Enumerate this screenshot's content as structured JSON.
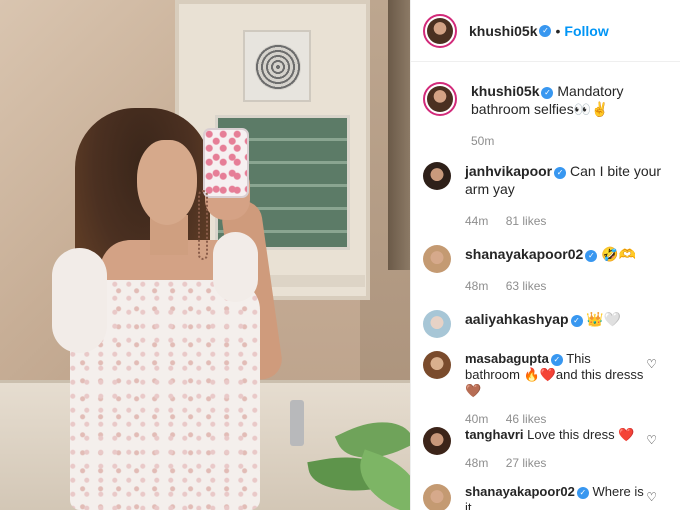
{
  "post": {
    "author": "khushi05k",
    "follow_label": "Follow",
    "separator": "•"
  },
  "caption": {
    "username": "khushi05k",
    "text": "Mandatory bathroom selfies👀✌",
    "time": "50m"
  },
  "comments": [
    {
      "username": "janhvikapoor",
      "text": "Can I bite your arm yay",
      "time": "44m",
      "likes": "81 likes"
    },
    {
      "username": "shanayakapoor02",
      "text": "🤣🫶",
      "time": "48m",
      "likes": "63 likes"
    },
    {
      "username": "aaliyahkashyap",
      "text": "👑🤍",
      "time": "",
      "likes": ""
    },
    {
      "username": "masabagupta",
      "text": "This bathroom 🔥❤️and this dresss 🤎",
      "time": "40m",
      "likes": "46 likes"
    },
    {
      "username": "tanghavri",
      "text": "Love this dress ❤️",
      "time": "48m",
      "likes": "27 likes"
    },
    {
      "username": "shanayakapoor02",
      "text": "Where is it",
      "time": "",
      "likes": ""
    }
  ],
  "icons": {
    "verified": "verified-badge-icon",
    "heart": "heart-outline-icon"
  },
  "colors": {
    "accent": "#0095f6",
    "verified": "#3897f0",
    "muted": "#8e8e8e"
  }
}
